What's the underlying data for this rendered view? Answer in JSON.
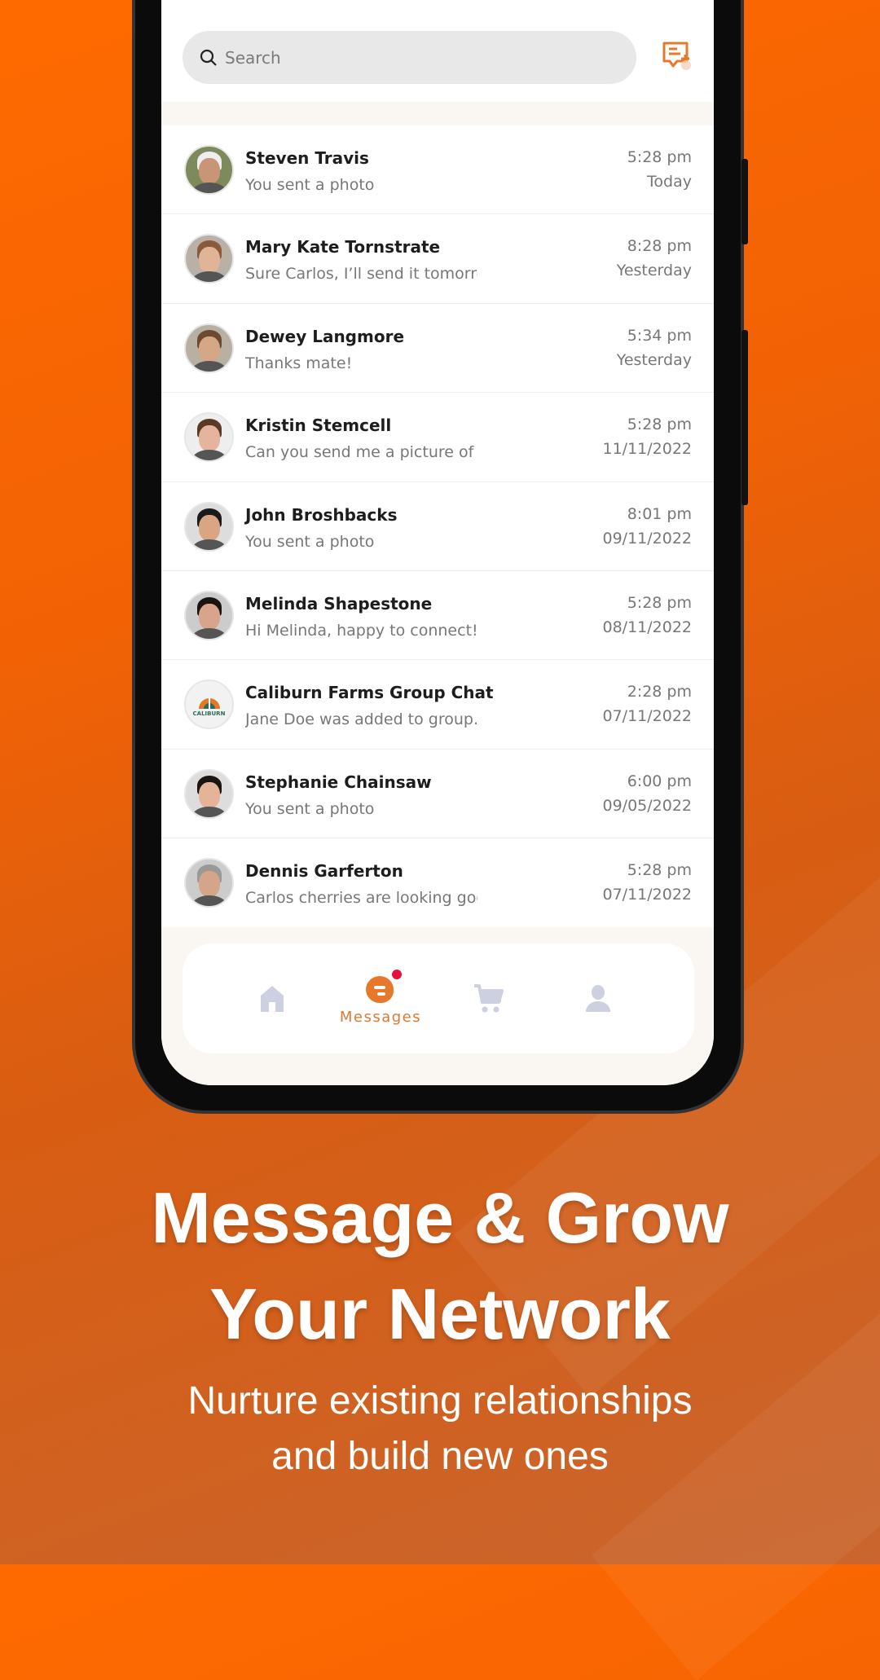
{
  "colors": {
    "accent": "#e5782b",
    "badge": "#e8113a",
    "nav_inactive": "#ccd0e0"
  },
  "search": {
    "placeholder": "Search"
  },
  "conversations": [
    {
      "name": "Steven Travis",
      "preview": "You sent a photo",
      "time": "5:28 pm",
      "date": "Today"
    },
    {
      "name": "Mary Kate Tornstrate",
      "preview": "Sure Carlos, I’ll send it  tomorrow",
      "time": "8:28 pm",
      "date": "Yesterday"
    },
    {
      "name": "Dewey Langmore",
      "preview": "Thanks mate!",
      "time": "5:34 pm",
      "date": "Yesterday"
    },
    {
      "name": "Kristin Stemcell",
      "preview": "Can you send me a  picture of cherries",
      "time": "5:28 pm",
      "date": "11/11/2022"
    },
    {
      "name": "John Broshbacks",
      "preview": "You sent a photo",
      "time": "8:01 pm",
      "date": "09/11/2022"
    },
    {
      "name": "Melinda Shapestone",
      "preview": "Hi Melinda, happy to connect!",
      "time": "5:28 pm",
      "date": "08/11/2022"
    },
    {
      "name": "Caliburn Farms Group Chat",
      "preview": "Jane Doe was added to group...",
      "time": "2:28 pm",
      "date": "07/11/2022",
      "logo": "CALIBURN"
    },
    {
      "name": "Stephanie Chainsaw",
      "preview": "You sent a photo",
      "time": "6:00 pm",
      "date": "09/05/2022"
    },
    {
      "name": "Dennis Garferton",
      "preview": "Carlos cherries are looking good",
      "time": "5:28 pm",
      "date": "07/11/2022"
    }
  ],
  "nav": {
    "items": [
      {
        "icon": "home-icon"
      },
      {
        "icon": "messages-icon",
        "label": "Messages",
        "active": true
      },
      {
        "icon": "cart-icon"
      },
      {
        "icon": "profile-icon"
      }
    ]
  },
  "headline": {
    "line1": "Message & Grow",
    "line2": "Your Network",
    "sub1": "Nurture existing relationships",
    "sub2": "and build new ones"
  }
}
